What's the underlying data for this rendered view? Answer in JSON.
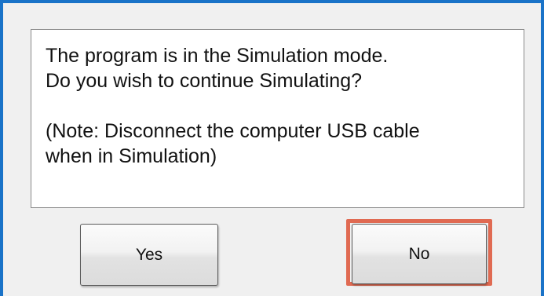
{
  "dialog": {
    "message": {
      "line1": "The program is in the Simulation mode.",
      "line2": "Do you wish to continue Simulating?",
      "line3": "(Note: Disconnect the computer USB cable",
      "line4": "when in Simulation)"
    },
    "buttons": {
      "yes_label": "Yes",
      "no_label": "No"
    },
    "colors": {
      "window_border": "#1a73c8",
      "highlight": "#e06a52"
    }
  }
}
